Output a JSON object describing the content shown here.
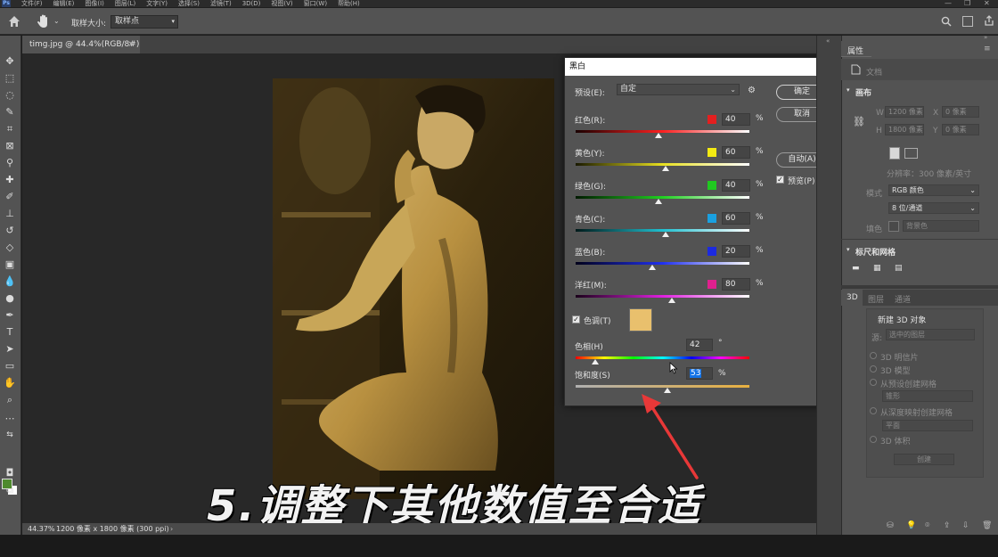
{
  "menubar": {
    "items": [
      "文件(F)",
      "编辑(E)",
      "图像(I)",
      "图层(L)",
      "文字(Y)",
      "选择(S)",
      "滤镜(T)",
      "3D(D)",
      "视图(V)",
      "窗口(W)",
      "帮助(H)"
    ],
    "logo": "Ps"
  },
  "options": {
    "sample_size_label": "取样大小:",
    "sample_size_value": "取样点"
  },
  "document": {
    "tab_title": "timg.jpg @ 44.4%(RGB/8#)",
    "zoom": "44.37%",
    "info": "1200 像素 x 1800 像素 (300 ppi)"
  },
  "caption": "5.调整下其他数值至合适",
  "dialog": {
    "title": "黑白",
    "preset_label": "预设(E):",
    "preset_value": "自定",
    "ok": "确定",
    "cancel": "取消",
    "auto": "自动(A)",
    "preview": "预览(P)",
    "rows": [
      {
        "label": "红色(R):",
        "value": "40",
        "color": "#e31f1f"
      },
      {
        "label": "黄色(Y):",
        "value": "60",
        "color": "#f3ea12"
      },
      {
        "label": "绿色(G):",
        "value": "40",
        "color": "#20c820"
      },
      {
        "label": "青色(C):",
        "value": "60",
        "color": "#1aa0e0"
      },
      {
        "label": "蓝色(B):",
        "value": "20",
        "color": "#1c2ae0"
      },
      {
        "label": "洋红(M):",
        "value": "80",
        "color": "#e0208e"
      }
    ],
    "tint_label": "色调(T)",
    "tint_color": "#e9c06d",
    "hue_label": "色相(H)",
    "hue_value": "42",
    "hue_unit": "°",
    "sat_label": "饱和度(S)",
    "sat_value": "53",
    "pct": "%"
  },
  "properties": {
    "tab": "属性",
    "doc_label": "文档",
    "canvas_section": "画布",
    "w_label": "W",
    "w_value": "1200 像素",
    "x_label": "X",
    "x_value": "0 像素",
    "h_label": "H",
    "h_value": "1800 像素",
    "y_label": "Y",
    "y_value": "0 像素",
    "resolution": "分辨率：300 像素/英寸",
    "mode_label": "模式",
    "mode_value": "RGB 颜色",
    "depth_value": "8 位/通道",
    "fill_label": "填色",
    "fill_value": "背景色",
    "rulers_section": "标尺和网格"
  },
  "panel3d": {
    "tabs": [
      "3D",
      "图层",
      "通道"
    ],
    "title": "新建 3D 对象",
    "source_label": "源:",
    "source_value": "选中的图层",
    "options": [
      "3D 明信片",
      "3D 模型",
      "从预设创建网格",
      "从深度映射创建网格",
      "3D 体积"
    ],
    "mesh_value": "锥形",
    "depth_map_value": "平面",
    "create": "创建"
  }
}
